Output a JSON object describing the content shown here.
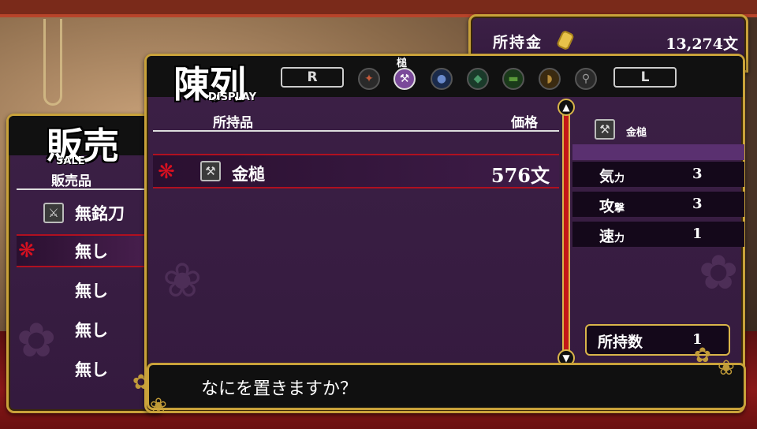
{
  "money": {
    "label": "所持金",
    "value": "13,274文"
  },
  "sale": {
    "title": "販売",
    "subtitle": "SALE",
    "header": "販売品",
    "items": [
      {
        "label": "無銘刀",
        "icon": "sword-icon"
      },
      {
        "label": "無し"
      },
      {
        "label": "無し"
      },
      {
        "label": "無し"
      },
      {
        "label": "無し"
      }
    ]
  },
  "display": {
    "title": "陳列",
    "subtitle": "DISPLAY",
    "key_right": "R",
    "key_left": "L",
    "active_category_label": "槌",
    "categories": [
      "fan-icon",
      "hammer-icon",
      "bag-icon",
      "leaf-icon",
      "scroll-icon",
      "horn-icon",
      "whip-icon"
    ],
    "col_item": "所持品",
    "col_price": "価格",
    "rows": [
      {
        "name": "金槌",
        "price": "576文",
        "icon": "hammer-icon"
      }
    ]
  },
  "detail": {
    "name": "金槌",
    "stats": [
      {
        "label": "気",
        "small": "力",
        "value": "3"
      },
      {
        "label": "攻",
        "small": "撃",
        "value": "3"
      },
      {
        "label": "速",
        "small": "力",
        "value": "1"
      }
    ],
    "owned_label": "所持数",
    "owned_value": "1"
  },
  "message": "なにを置きますか？"
}
